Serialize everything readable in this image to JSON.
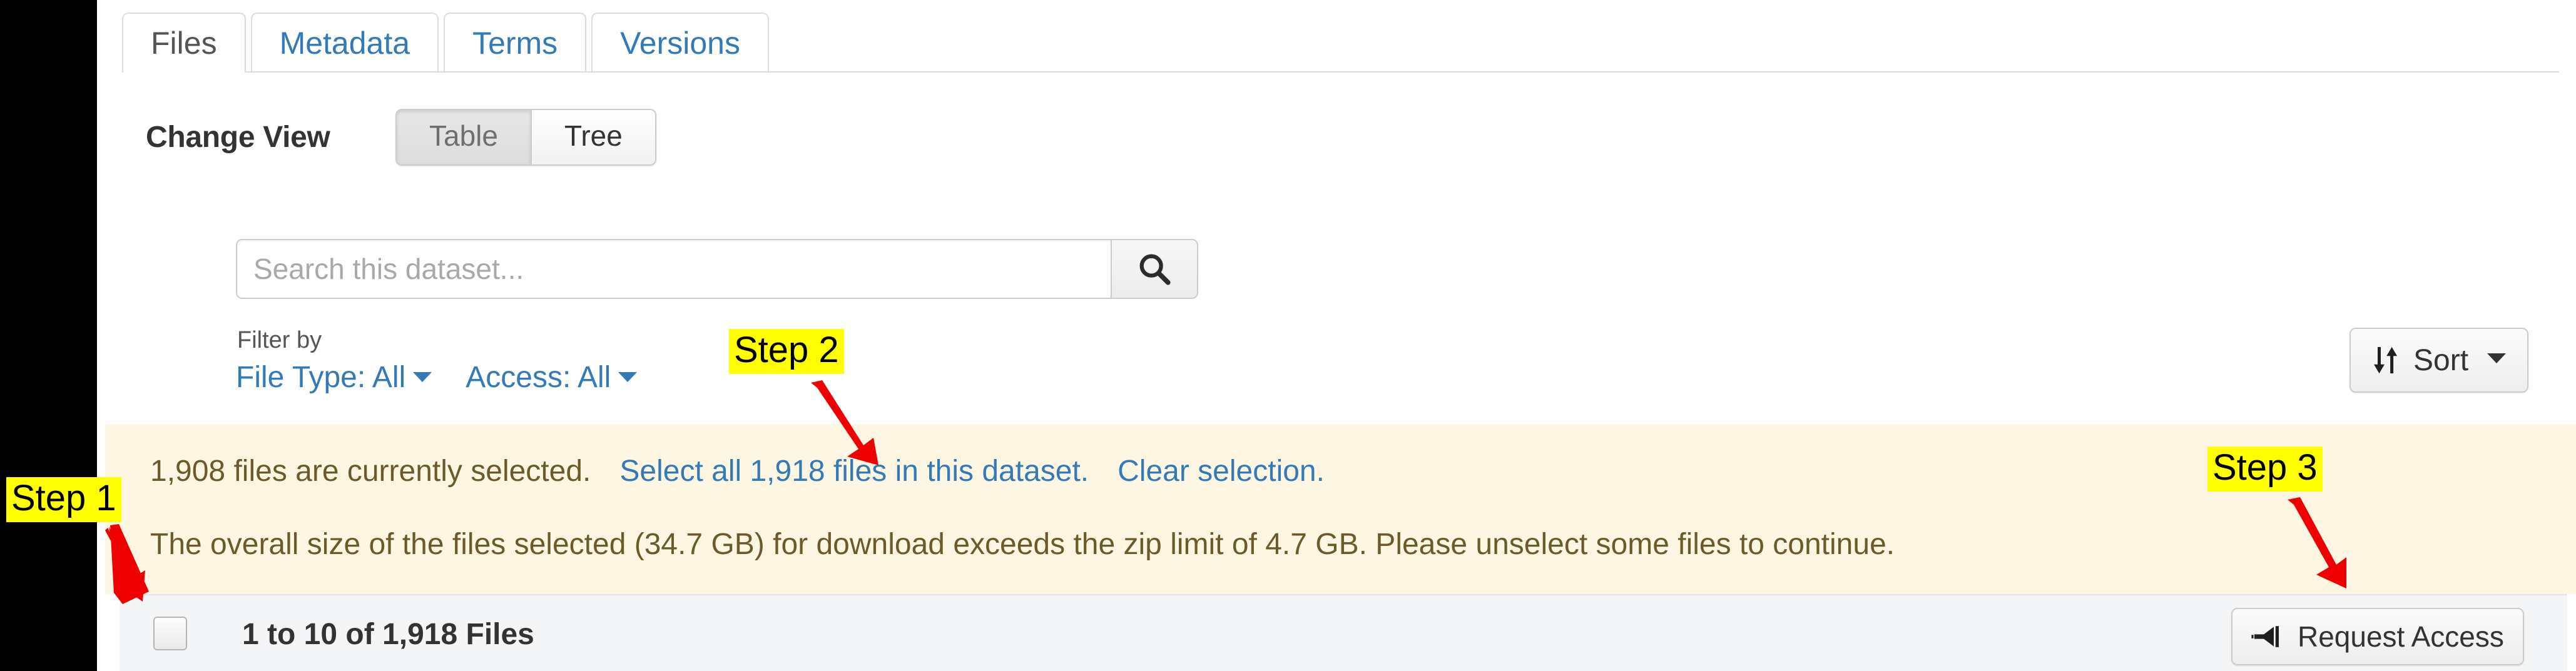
{
  "tabs": [
    {
      "label": "Files",
      "active": true
    },
    {
      "label": "Metadata",
      "active": false
    },
    {
      "label": "Terms",
      "active": false
    },
    {
      "label": "Versions",
      "active": false
    }
  ],
  "change_view": {
    "label": "Change View",
    "options": [
      {
        "label": "Table",
        "selected": true
      },
      {
        "label": "Tree",
        "selected": false
      }
    ]
  },
  "search": {
    "placeholder": "Search this dataset...",
    "value": "",
    "button_icon": "search-icon"
  },
  "filter": {
    "label": "Filter by",
    "links": [
      {
        "label": "File Type: All"
      },
      {
        "label": "Access: All"
      }
    ]
  },
  "sort": {
    "label": "Sort",
    "icon": "sort-updown-icon"
  },
  "alert": {
    "selected_text": "1,908 files are currently selected.",
    "select_all_link": "Select all 1,918 files in this dataset.",
    "clear_selection_link": "Clear selection.",
    "size_warning": "The overall size of the files selected (34.7 GB) for download exceeds the zip limit of 4.7 GB. Please unselect some files to continue."
  },
  "table_header": {
    "file_count_label": "1 to 10 of 1,918 Files",
    "select_all_checkbox_checked": false
  },
  "request_access": {
    "label": "Request Access",
    "icon": "bullhorn-icon"
  },
  "annotations": [
    {
      "label": "Step 1"
    },
    {
      "label": "Step 2"
    },
    {
      "label": "Step 3"
    }
  ],
  "colors": {
    "link": "#337ab7",
    "alert_bg": "#fcf6e3",
    "alert_text": "#6b5b2a",
    "annotation_bg": "#ffff00",
    "annotation_arrow": "#ee0000",
    "table_head_bg": "#f4f5f6"
  }
}
